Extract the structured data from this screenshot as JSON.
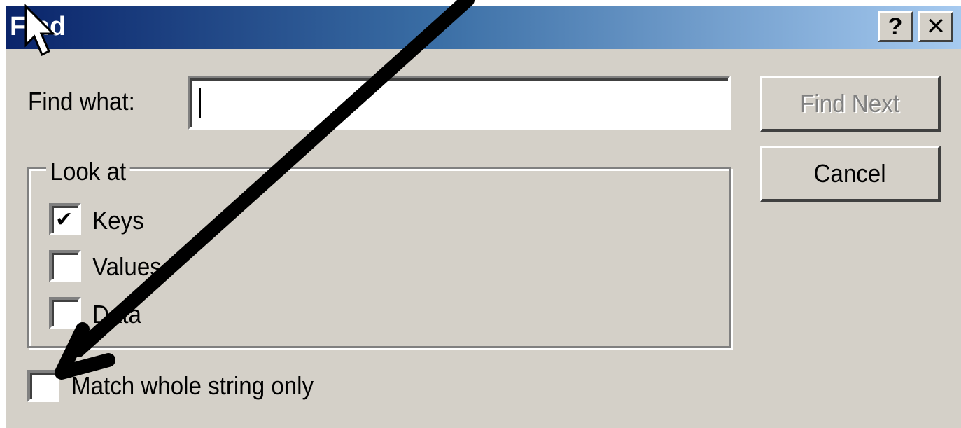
{
  "window": {
    "title": "Find",
    "help_button": "?",
    "close_button": "✕"
  },
  "find_what": {
    "label": "Find what:",
    "value": ""
  },
  "buttons": {
    "find_next": "Find Next",
    "cancel": "Cancel"
  },
  "look_at": {
    "label": "Look at",
    "options": [
      {
        "label": "Keys",
        "checked": true
      },
      {
        "label": "Values",
        "checked": false
      },
      {
        "label": "Data",
        "checked": false
      }
    ]
  },
  "match_whole": {
    "label": "Match whole string only",
    "checked": false
  },
  "icons": {
    "cursor": "mouse-pointer-icon",
    "arrow": "annotation-arrow"
  }
}
